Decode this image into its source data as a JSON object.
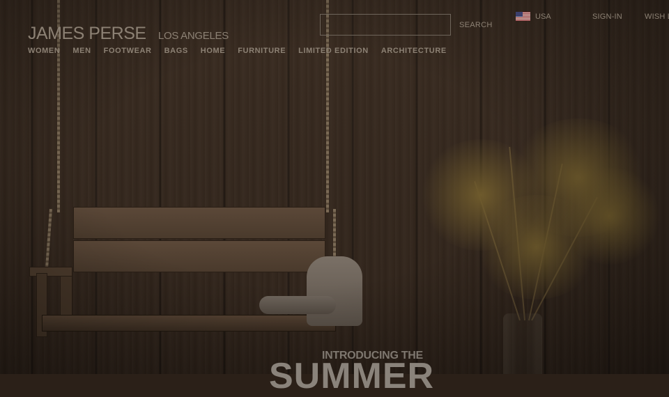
{
  "brand": {
    "name": "JAMES PERSE",
    "location": "LOS ANGELES"
  },
  "nav": {
    "items": [
      "WOMEN",
      "MEN",
      "FOOTWEAR",
      "BAGS",
      "HOME",
      "FURNITURE",
      "LIMITED EDITION",
      "ARCHITECTURE"
    ]
  },
  "search": {
    "value": "",
    "button_label": "SEARCH"
  },
  "locale": {
    "country": "USA",
    "flag_icon": "us-flag-icon"
  },
  "account": {
    "signin_label": "SIGN-IN",
    "wishlist_label": "WISH LIST"
  },
  "hero": {
    "intro_text": "INTRODUCING THE",
    "headline": "SUMMER"
  },
  "colors": {
    "header_text": "#8c8174",
    "background": "#35281e"
  }
}
